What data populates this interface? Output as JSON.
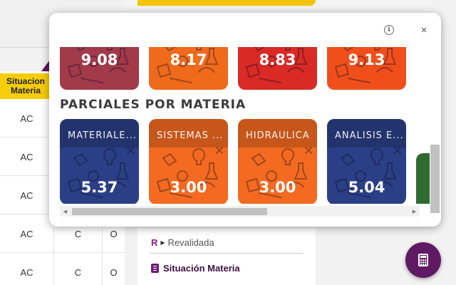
{
  "background": {
    "table_header": "Situacion Materia",
    "rows": [
      {
        "status": "AC",
        "c2": "",
        "c3": ""
      },
      {
        "status": "AC",
        "c2": "",
        "c3": ""
      },
      {
        "status": "AC",
        "c2": "",
        "c3": ""
      },
      {
        "status": "AC",
        "c2": "C",
        "c3": "O"
      },
      {
        "status": "AC",
        "c2": "C",
        "c3": "O"
      }
    ],
    "legend": {
      "r_letter": "R",
      "r_label": "Revalidada",
      "situacion_label": "Situación Materia"
    },
    "fab_icon": "calculator-icon"
  },
  "popup": {
    "info_icon": "info-icon",
    "close_label": "×",
    "top_tiles": [
      {
        "grade": "9.08",
        "color": "#a23a4a"
      },
      {
        "grade": "8.17",
        "color": "#f06a1c"
      },
      {
        "grade": "8.83",
        "color": "#d92a26"
      },
      {
        "grade": "9.13",
        "color": "#f04f1c"
      }
    ],
    "section_title": "PARCIALES POR MATERIA",
    "tiles": [
      {
        "name": "MATERIALE...",
        "grade": "5.37",
        "color": "#2b3f86"
      },
      {
        "name": "SISTEMAS ...",
        "grade": "3.00",
        "color": "#f36a20"
      },
      {
        "name": "HIDRAULICA",
        "grade": "3.00",
        "color": "#f36a20"
      },
      {
        "name": "ANALISIS E...",
        "grade": "5.04",
        "color": "#2b3f86"
      }
    ]
  }
}
